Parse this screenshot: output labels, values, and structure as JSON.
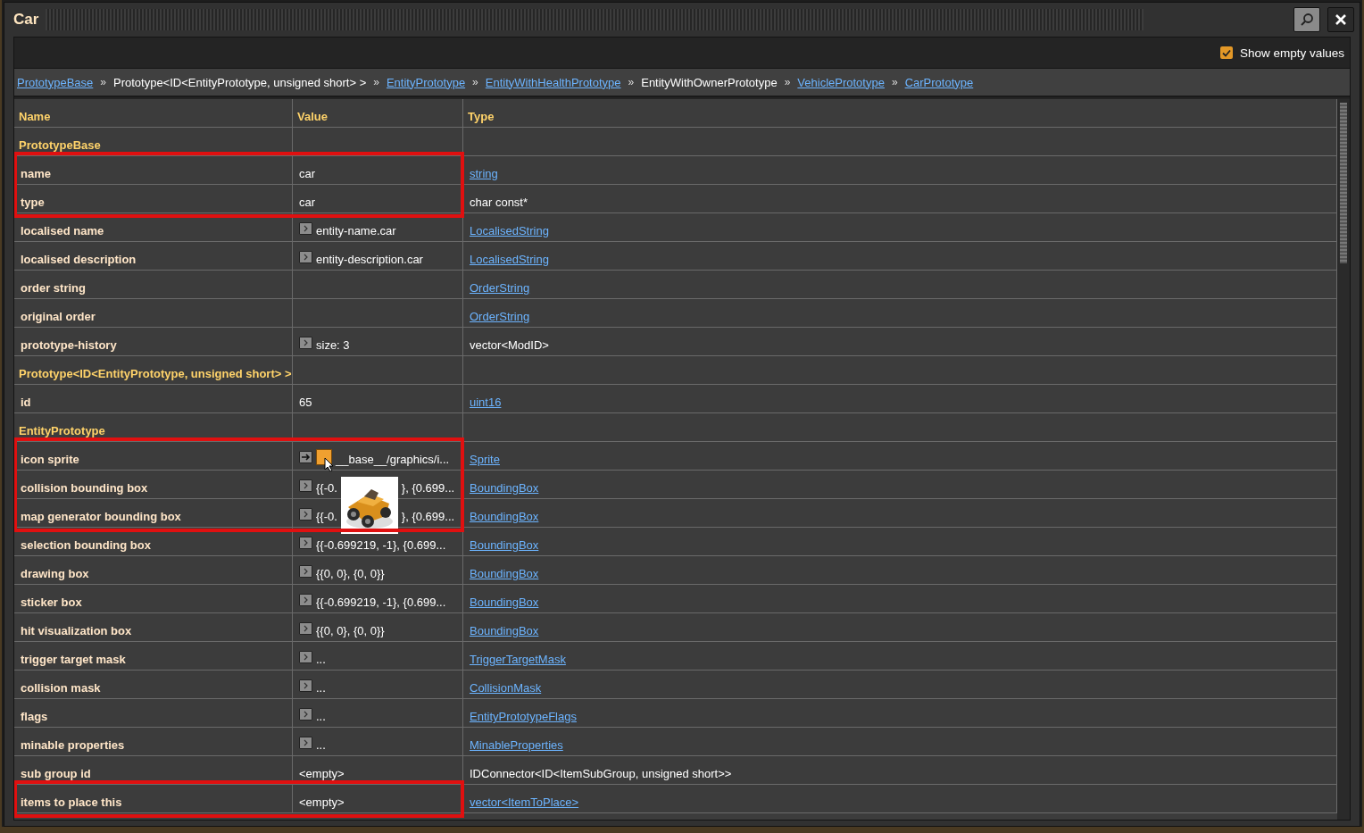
{
  "window": {
    "title": "Car"
  },
  "show_empty_values": {
    "label": "Show empty values",
    "checked": true
  },
  "breadcrumb": [
    {
      "label": "PrototypeBase",
      "link": true
    },
    {
      "label": "Prototype<ID<EntityPrototype, unsigned short> >",
      "link": false
    },
    {
      "label": "EntityPrototype",
      "link": true
    },
    {
      "label": "EntityWithHealthPrototype",
      "link": true
    },
    {
      "label": "EntityWithOwnerPrototype",
      "link": false
    },
    {
      "label": "VehiclePrototype",
      "link": true
    },
    {
      "label": "CarPrototype",
      "link": true
    }
  ],
  "breadcrumb_separator": "»",
  "table": {
    "columns": [
      "Name",
      "Value",
      "Type"
    ],
    "groups": [
      {
        "highlighted": false,
        "rows": [
          {
            "kind": "section",
            "name": "PrototypeBase"
          }
        ]
      },
      {
        "highlighted": true,
        "rows": [
          {
            "kind": "row",
            "name": "name",
            "value": [
              "car"
            ],
            "type": "string",
            "link": true
          },
          {
            "kind": "row",
            "name": "type",
            "value": [
              "car"
            ],
            "type": "char const*",
            "link": false
          }
        ]
      },
      {
        "highlighted": false,
        "rows": [
          {
            "kind": "row",
            "name": "localised name",
            "control": {
              "kind": "expand"
            },
            "value": [
              "entity-name.car"
            ],
            "type": "LocalisedString",
            "link": true
          },
          {
            "kind": "row",
            "name": "localised description",
            "control": {
              "kind": "expand"
            },
            "value": [
              "entity-description.car"
            ],
            "type": "LocalisedString",
            "link": true
          },
          {
            "kind": "row",
            "name": "order string",
            "type": "OrderString",
            "link": true
          },
          {
            "kind": "row",
            "name": "original order",
            "type": "OrderString",
            "link": true
          },
          {
            "kind": "row",
            "name": "prototype-history",
            "control": {
              "kind": "expand"
            },
            "value": [
              "size: 3"
            ],
            "type": "vector<ModID>",
            "link": false
          },
          {
            "kind": "section",
            "name": "Prototype<ID<EntityPrototype, unsigned short> >"
          },
          {
            "kind": "row",
            "name": "id",
            "value": [
              "65"
            ],
            "type": "uint16",
            "link": true
          },
          {
            "kind": "section",
            "name": "EntityPrototype"
          }
        ]
      },
      {
        "highlighted": true,
        "rows": [
          {
            "kind": "row",
            "name": "icon sprite",
            "control": {
              "kind": "goto"
            },
            "slot": true,
            "value": [
              "__base__/graphics/i..."
            ],
            "type": "Sprite",
            "link": true
          },
          {
            "kind": "row",
            "name": "collision bounding box",
            "control": {
              "kind": "expand"
            },
            "value": [
              "{{-0.",
              "}, {0.699..."
            ],
            "preview": {
              "kind": "picture"
            },
            "type": "BoundingBox",
            "link": true
          },
          {
            "kind": "row",
            "name": "map generator bounding box",
            "control": {
              "kind": "expand"
            },
            "value": [
              "{{-0.",
              "}, {0.699..."
            ],
            "type": "BoundingBox",
            "link": true
          }
        ]
      },
      {
        "highlighted": false,
        "rows": [
          {
            "kind": "row",
            "name": "selection bounding box",
            "control": {
              "kind": "expand"
            },
            "value": [
              "{{-0.699219, -1}, {0.699..."
            ],
            "type": "BoundingBox",
            "link": true
          },
          {
            "kind": "row",
            "name": "drawing box",
            "control": {
              "kind": "expand"
            },
            "value": [
              "{{0, 0}, {0, 0}}"
            ],
            "type": "BoundingBox",
            "link": true
          },
          {
            "kind": "row",
            "name": "sticker box",
            "control": {
              "kind": "expand"
            },
            "value": [
              "{{-0.699219, -1}, {0.699..."
            ],
            "type": "BoundingBox",
            "link": true
          },
          {
            "kind": "row",
            "name": "hit visualization box",
            "control": {
              "kind": "expand"
            },
            "value": [
              "{{0, 0}, {0, 0}}"
            ],
            "type": "BoundingBox",
            "link": true
          },
          {
            "kind": "row",
            "name": "trigger target mask",
            "control": {
              "kind": "expand"
            },
            "value": [
              "..."
            ],
            "type": "TriggerTargetMask",
            "link": true
          },
          {
            "kind": "row",
            "name": "collision mask",
            "control": {
              "kind": "expand"
            },
            "value": [
              "..."
            ],
            "type": "CollisionMask",
            "link": true
          },
          {
            "kind": "row",
            "name": "flags",
            "control": {
              "kind": "expand"
            },
            "value": [
              "..."
            ],
            "type": "EntityPrototypeFlags",
            "link": true
          },
          {
            "kind": "row",
            "name": "minable properties",
            "control": {
              "kind": "expand"
            },
            "value": [
              "..."
            ],
            "type": "MinableProperties",
            "link": true
          },
          {
            "kind": "row",
            "name": "sub group id",
            "value": [
              "<empty>"
            ],
            "type": "IDConnector<ID<ItemSubGroup, unsigned short>>",
            "link": false
          }
        ]
      },
      {
        "highlighted": true,
        "rows": [
          {
            "kind": "row",
            "name": "items to place this",
            "value": [
              "<empty>"
            ],
            "type": "vector<ItemToPlace>",
            "link": true
          }
        ]
      }
    ]
  }
}
